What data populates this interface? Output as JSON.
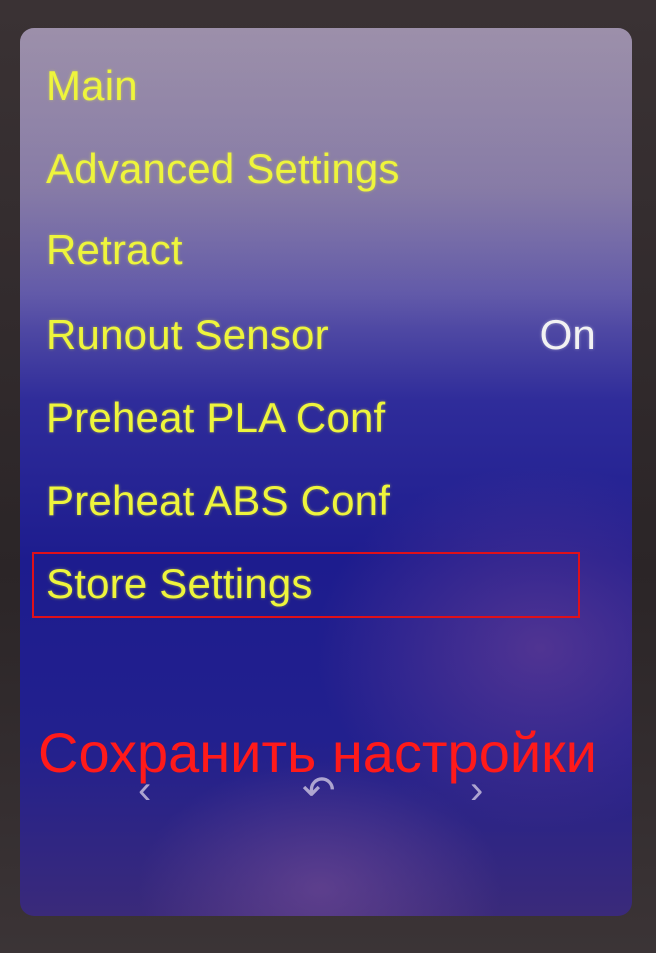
{
  "menu": {
    "items": [
      {
        "label": "Main",
        "value": ""
      },
      {
        "label": "Advanced Settings",
        "value": ""
      },
      {
        "label": "Retract",
        "value": ""
      },
      {
        "label": "Runout Sensor",
        "value": "On"
      },
      {
        "label": "Preheat PLA Conf",
        "value": ""
      },
      {
        "label": "Preheat ABS Conf",
        "value": ""
      },
      {
        "label": "Store Settings",
        "value": ""
      }
    ],
    "selected_index": 6
  },
  "nav": {
    "prev_icon": "chevron-left-icon",
    "back_icon": "back-arrow-icon",
    "next_icon": "chevron-right-icon"
  },
  "annotation": {
    "text": "Сохранить настройки",
    "color": "#ff1a1a",
    "highlight_color": "#e0101a"
  },
  "colors": {
    "menu_text": "#eef53c",
    "value_text": "#f2f2f2"
  }
}
